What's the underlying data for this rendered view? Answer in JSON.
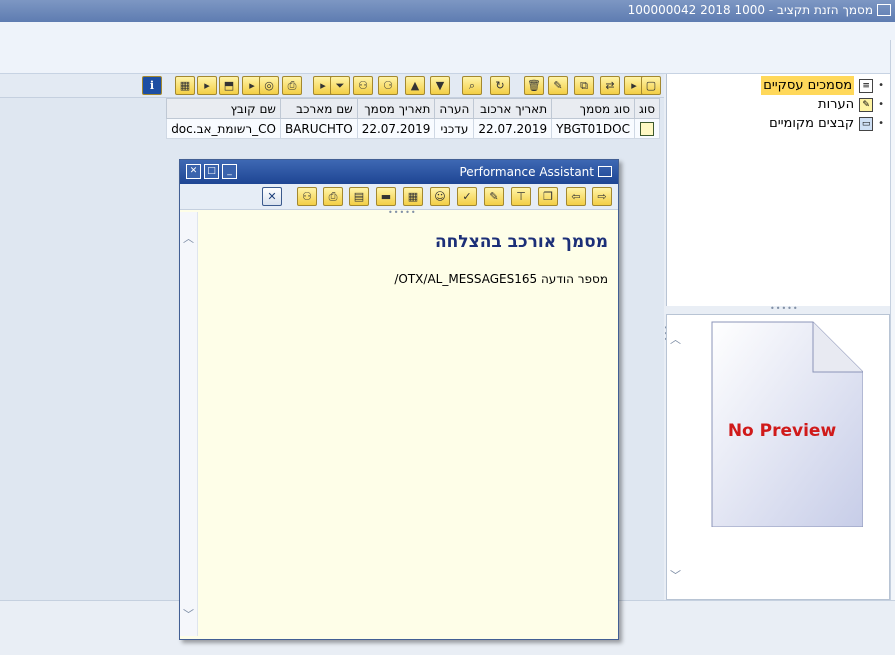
{
  "window": {
    "title": "מסמך הזנת תקציב - 1000 2018 100000042"
  },
  "grid": {
    "columns": [
      "סוג",
      "סוג מסמך",
      "תאריך ארכוב",
      "הערה",
      "תאריך מסמך",
      "שם מארכב",
      "שם קובץ"
    ],
    "rows": [
      {
        "doc_type": "YBGT01DOC",
        "archive_date": "22.07.2019",
        "note": "עדכני",
        "doc_date": "22.07.2019",
        "archiver": "BARUCHTO",
        "file_name": "CO_רשומת_אב.doc"
      }
    ]
  },
  "tree": {
    "items": [
      {
        "label": "מסמכים עסקיים",
        "icon": "document-icon",
        "selected": true
      },
      {
        "label": "הערות",
        "icon": "pencil-note-icon",
        "selected": false
      },
      {
        "label": "קבצים מקומיים",
        "icon": "monitor-icon",
        "selected": false
      }
    ]
  },
  "preview": {
    "text": "No Preview"
  },
  "assistant": {
    "title": "Performance Assistant",
    "heading": "מסמך אורכב בהצלחה",
    "message": "מספר הודעה OTX/AL_MESSAGES165/"
  },
  "colors": {
    "accent": "#1e4593",
    "toolbar_yellow": "#f3cf45",
    "selection": "#ffd85a",
    "no_preview_red": "#d01a1a"
  }
}
